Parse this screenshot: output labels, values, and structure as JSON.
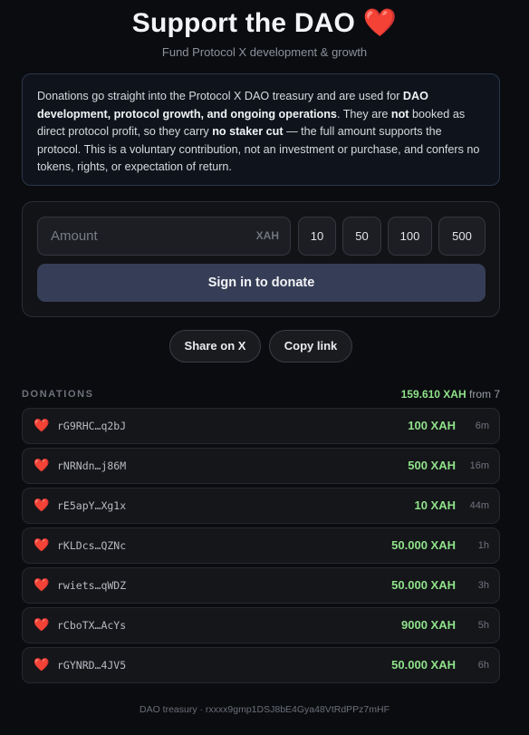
{
  "header": {
    "title": "Support the DAO",
    "title_icon": "heart",
    "subtitle": "Fund Protocol X development & growth"
  },
  "notice": {
    "p1": "Donations go straight into the Protocol X DAO treasury and are used for ",
    "b1": "DAO development, protocol growth, and ongoing operations",
    "p2": ". They are ",
    "b2": "not",
    "p3": " booked as direct protocol profit, so they carry ",
    "b3": "no staker cut",
    "p4": " — the full amount supports the protocol. This is a voluntary contribution, not an investment or purchase, and confers no tokens, rights, or expectation of return."
  },
  "donate": {
    "amount_placeholder": "Amount",
    "amount_value": "",
    "unit": "XAH",
    "presets": [
      "10",
      "50",
      "100",
      "500"
    ],
    "signin_label": "Sign in to donate"
  },
  "share": {
    "share_label": "Share on X",
    "copy_label": "Copy link"
  },
  "donations": {
    "header": "DONATIONS",
    "total": "159.610 XAH",
    "from_label": "from 7",
    "items": [
      {
        "addr": "rG9RHC…q2bJ",
        "amount": "100 XAH",
        "time": "6m"
      },
      {
        "addr": "rNRNdn…j86M",
        "amount": "500 XAH",
        "time": "16m"
      },
      {
        "addr": "rE5apY…Xg1x",
        "amount": "10 XAH",
        "time": "44m"
      },
      {
        "addr": "rKLDcs…QZNc",
        "amount": "50.000 XAH",
        "time": "1h"
      },
      {
        "addr": "rwiets…qWDZ",
        "amount": "50.000 XAH",
        "time": "3h"
      },
      {
        "addr": "rCboTX…AcYs",
        "amount": "9000 XAH",
        "time": "5h"
      },
      {
        "addr": "rGYNRD…4JV5",
        "amount": "50.000 XAH",
        "time": "6h"
      }
    ]
  },
  "footer": {
    "text": "DAO treasury · rxxxx9gmp1DSJ8bE4Gya48VtRdPPz7mHF"
  },
  "colors": {
    "accent_green": "#8fe28a",
    "heart_red": "#e0483b",
    "button_bg": "#363e57"
  }
}
